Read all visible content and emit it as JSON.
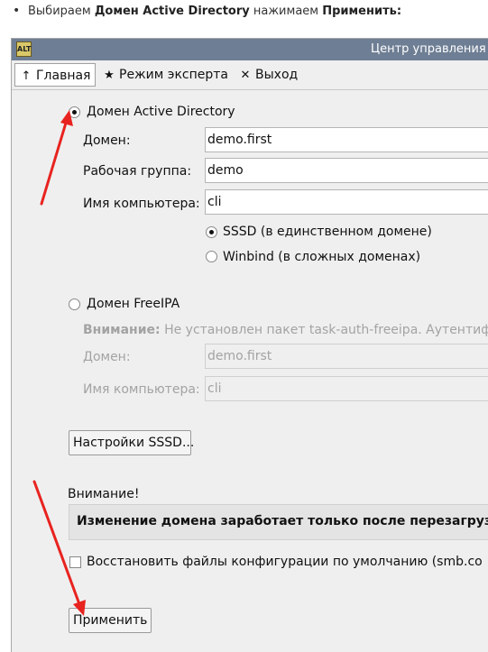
{
  "doc": {
    "bullet": "•",
    "prefix": "Выбираем ",
    "bold1": "Домен Active Directory",
    "middle": " нажимаем ",
    "bold2": "Применить:"
  },
  "window": {
    "title": "Центр управления",
    "app_icon_text": "ALT"
  },
  "toolbar": {
    "home": {
      "icon": "↑",
      "label": "Главная"
    },
    "expert": {
      "icon": "★",
      "label": "Режим эксперта"
    },
    "exit": {
      "icon": "✕",
      "label": "Выход"
    }
  },
  "ad": {
    "option_label": "Домен Active Directory",
    "selected": true,
    "domain_label": "Домен:",
    "domain_value": "demo.first",
    "workgroup_label": "Рабочая группа:",
    "workgroup_value": "demo",
    "computer_label": "Имя компьютера:",
    "computer_value": "cli",
    "sssd_label": "SSSD (в единственном домене)",
    "winbind_label": "Winbind (в сложных доменах)"
  },
  "freeipa": {
    "option_label": "Домен FreeIPA",
    "warning_bold": "Внимание:",
    "warning_text": " Не установлен пакет task-auth-freeipa. Аутентифи",
    "domain_label": "Домен:",
    "domain_value": "demo.first",
    "computer_label": "Имя компьютера:",
    "computer_value": "cli"
  },
  "sssd_settings_button": "Настройки SSSD...",
  "attention_label": "Внимание!",
  "notice_text": "Изменение домена заработает только после перезагрузк",
  "restore_checkbox_label": "Восстановить файлы конфигурации по умолчанию (smb.co",
  "apply_button": "Применить",
  "colors": {
    "titlebar": "#6e7e94",
    "arrow": "#e8231f"
  }
}
